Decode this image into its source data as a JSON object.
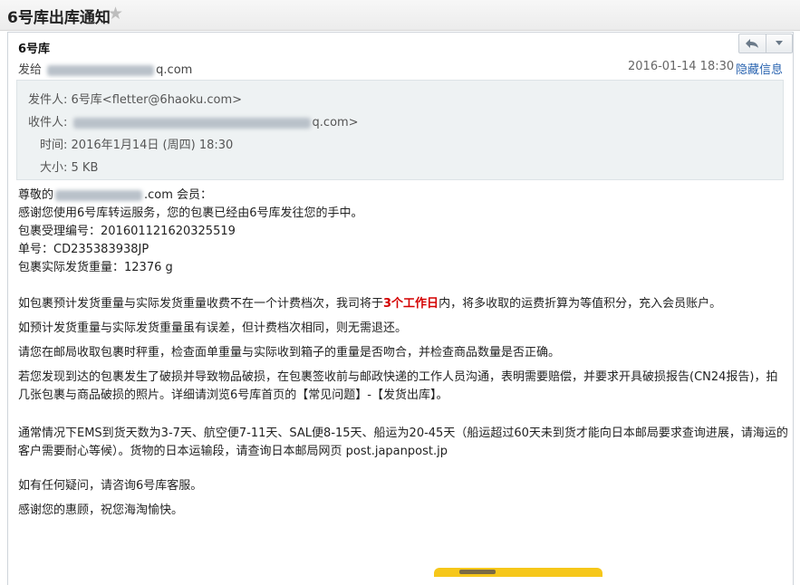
{
  "mail": {
    "title": "6号库出库通知",
    "from_name": "6号库",
    "send_to_prefix": "发给",
    "send_to_suffix": "q.com",
    "date": "2016-01-14 18:30",
    "hide_info": "隐藏信息"
  },
  "details": {
    "from_label": "发件人:",
    "from_value": "6号库<fletter@6haoku.com>",
    "to_label": "收件人:",
    "to_suffix": "q.com>",
    "time_label": "时间:",
    "time_value": "2016年1月14日 (周四) 18:30",
    "size_label": "大小:",
    "size_value": "5 KB"
  },
  "body": {
    "greeting_prefix": "尊敬的",
    "greeting_suffix": ".com 会员：",
    "line1": "感谢您使用6号库转运服务，您的包裹已经由6号库发往您的手中。",
    "line2": "包裹受理编号：201601121620325519",
    "line3": "单号：CD235383938JP",
    "line4": "包裹实际发货重量：12376 g",
    "p1_before": "如包裹预计发货重量与实际发货重量收费不在一个计费档次，我司将于",
    "p1_highlight": "3个工作日",
    "p1_after": "内，将多收取的运费折算为等值积分，充入会员账户。",
    "p2": "如预计发货重量与实际发货重量虽有误差，但计费档次相同，则无需退还。",
    "p3": "请您在邮局收取包裹时秤重，检查面单重量与实际收到箱子的重量是否吻合，并检查商品数量是否正确。",
    "p4": "若您发现到达的包裹发生了破损并导致物品破损，在包裹签收前与邮政快递的工作人员沟通，表明需要赔偿，并要求开具破损报告(CN24报告)，拍几张包裹与商品破损的照片。详细请浏览6号库首页的【常见问题】-【发货出库】。",
    "p5": "通常情况下EMS到货天数为3-7天、航空便7-11天、SAL便8-15天、船运为20-45天（船运超过60天未到货才能向日本邮局要求查询进展，请海运的客户需要耐心等候）。货物的日本运输段，请查询日本邮局网页 post.japanpost.jp",
    "p6": "如有任何疑问，请咨询6号库客服。",
    "p7": "感谢您的惠顾，祝您海淘愉快。"
  },
  "icons": {
    "star": "star-icon",
    "reply": "reply-icon",
    "more": "chevron-down-icon"
  },
  "colors": {
    "highlight": "#d40000",
    "link": "#2a64b0",
    "details_bg": "#eef2f3"
  }
}
